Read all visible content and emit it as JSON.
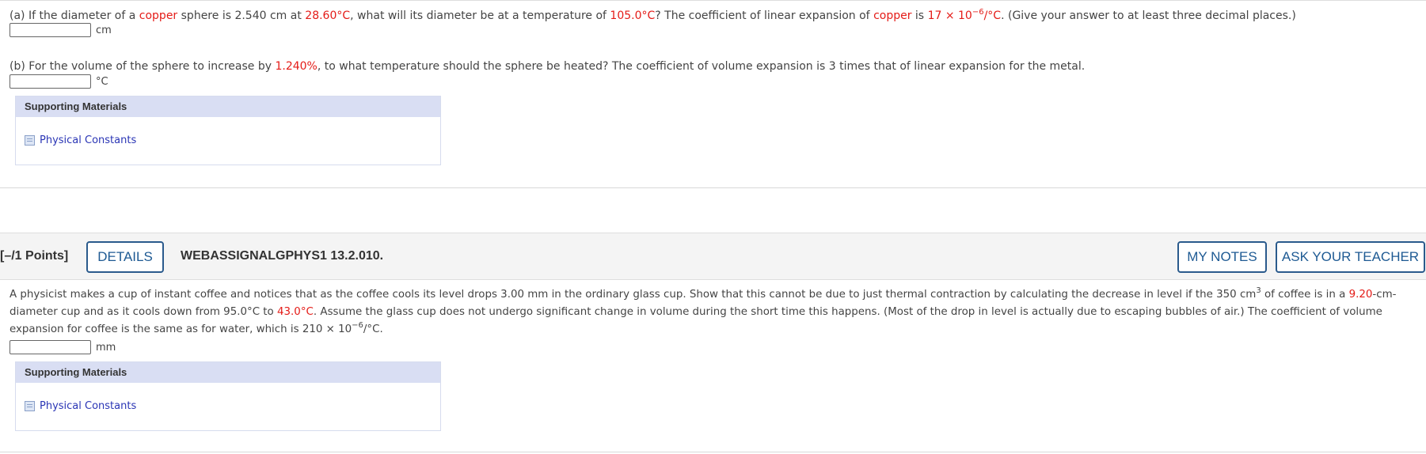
{
  "q1": {
    "partA": {
      "t1": "(a) If the diameter of a ",
      "metal": "copper",
      "t2": " sphere is 2.540 cm at ",
      "temp1": "28.60°C",
      "t3": ", what will its diameter be at a temperature of ",
      "temp2": "105.0°C",
      "t4": "? The coefficient of linear expansion of ",
      "metal2": "copper",
      "t5": " is ",
      "coef": "17 × 10",
      "coef_exp": "−6",
      "coef_unit": "/°C",
      "t6": ". (Give your answer to at least three decimal places.)",
      "unit": "cm"
    },
    "partB": {
      "t1": "(b) For the volume of the sphere to increase by ",
      "pct": "1.240%",
      "t2": ", to what temperature should the sphere be heated? The coefficient of volume expansion is 3 times that of linear expansion for the metal.",
      "unit": "°C"
    },
    "support": {
      "heading": "Supporting Materials",
      "link": "Physical Constants"
    }
  },
  "q2": {
    "points": "[–/1 Points]",
    "details_label": "DETAILS",
    "question_id": "WEBASSIGNALGPHYS1 13.2.010.",
    "my_notes_label": "MY NOTES",
    "ask_teacher_label": "ASK YOUR TEACHER",
    "text": {
      "t1": "A physicist makes a cup of instant coffee and notices that as the coffee cools its level drops 3.00 mm in the ordinary glass cup. Show that this cannot be due to just thermal contraction by calculating the decrease in level if the 350 cm",
      "sup3": "3",
      "t2": " of coffee is in a ",
      "diameter": "9.20",
      "t3": "-cm-diameter cup and as it cools down from 95.0°C to ",
      "temp": "43.0°C",
      "t4": ". Assume the glass cup does not undergo significant change in volume during the short time this happens. (Most of the drop in level is actually due to escaping bubbles of air.) The coefficient of volume expansion for coffee is the same as for water, which is 210 × 10",
      "exp": "−6",
      "t5": "/°C."
    },
    "unit": "mm",
    "support": {
      "heading": "Supporting Materials",
      "link": "Physical Constants"
    }
  }
}
